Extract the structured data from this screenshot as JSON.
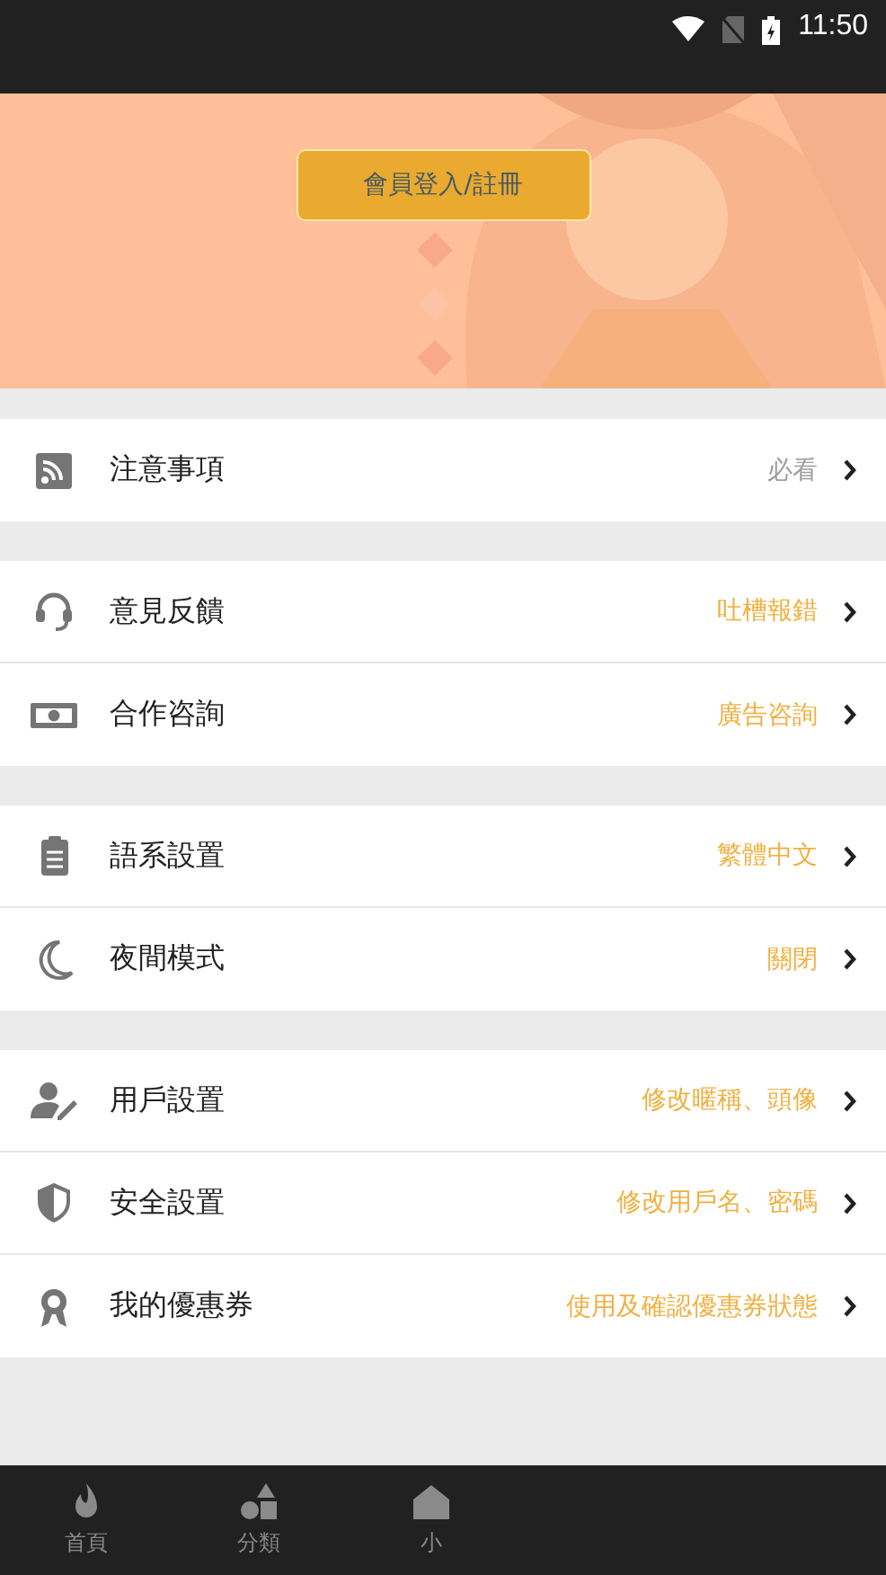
{
  "status_bar": {
    "time": "11:50"
  },
  "banner": {
    "kind": "picture",
    "login_button": "會員登入/註冊"
  },
  "sections": [
    {
      "items": [
        {
          "kind": "rss",
          "label": "注意事項",
          "value": "必看",
          "color": "#9e9e9e"
        }
      ]
    },
    {
      "items": [
        {
          "kind": "headset",
          "label": "意見反饋",
          "value": "吐槽報錯",
          "color": "#f0b040"
        },
        {
          "kind": "money",
          "label": "合作咨詢",
          "value": "廣告咨詢",
          "color": "#f0b040"
        }
      ]
    },
    {
      "items": [
        {
          "kind": "clipboard",
          "label": "語系設置",
          "value": "繁體中文",
          "color": "#f0b040"
        },
        {
          "kind": "moon",
          "label": "夜間模式",
          "value": "關閉",
          "color": "#f0b040"
        }
      ]
    },
    {
      "items": [
        {
          "kind": "user",
          "label": "用戶設置",
          "value": "修改暱稱、頭像",
          "color": "#f0b040"
        },
        {
          "kind": "shield",
          "label": "安全設置",
          "value": "修改用戶名、密碼",
          "color": "#f0b040"
        },
        {
          "kind": "award",
          "label": "我的優惠券",
          "value": "使用及確認優惠券狀態",
          "color": "#f0b040"
        }
      ]
    }
  ],
  "bottom_nav": [
    {
      "kind": "flame",
      "label": "首頁"
    },
    {
      "kind": "shapes",
      "label": "分類"
    },
    {
      "kind": "home",
      "label": "小"
    }
  ]
}
